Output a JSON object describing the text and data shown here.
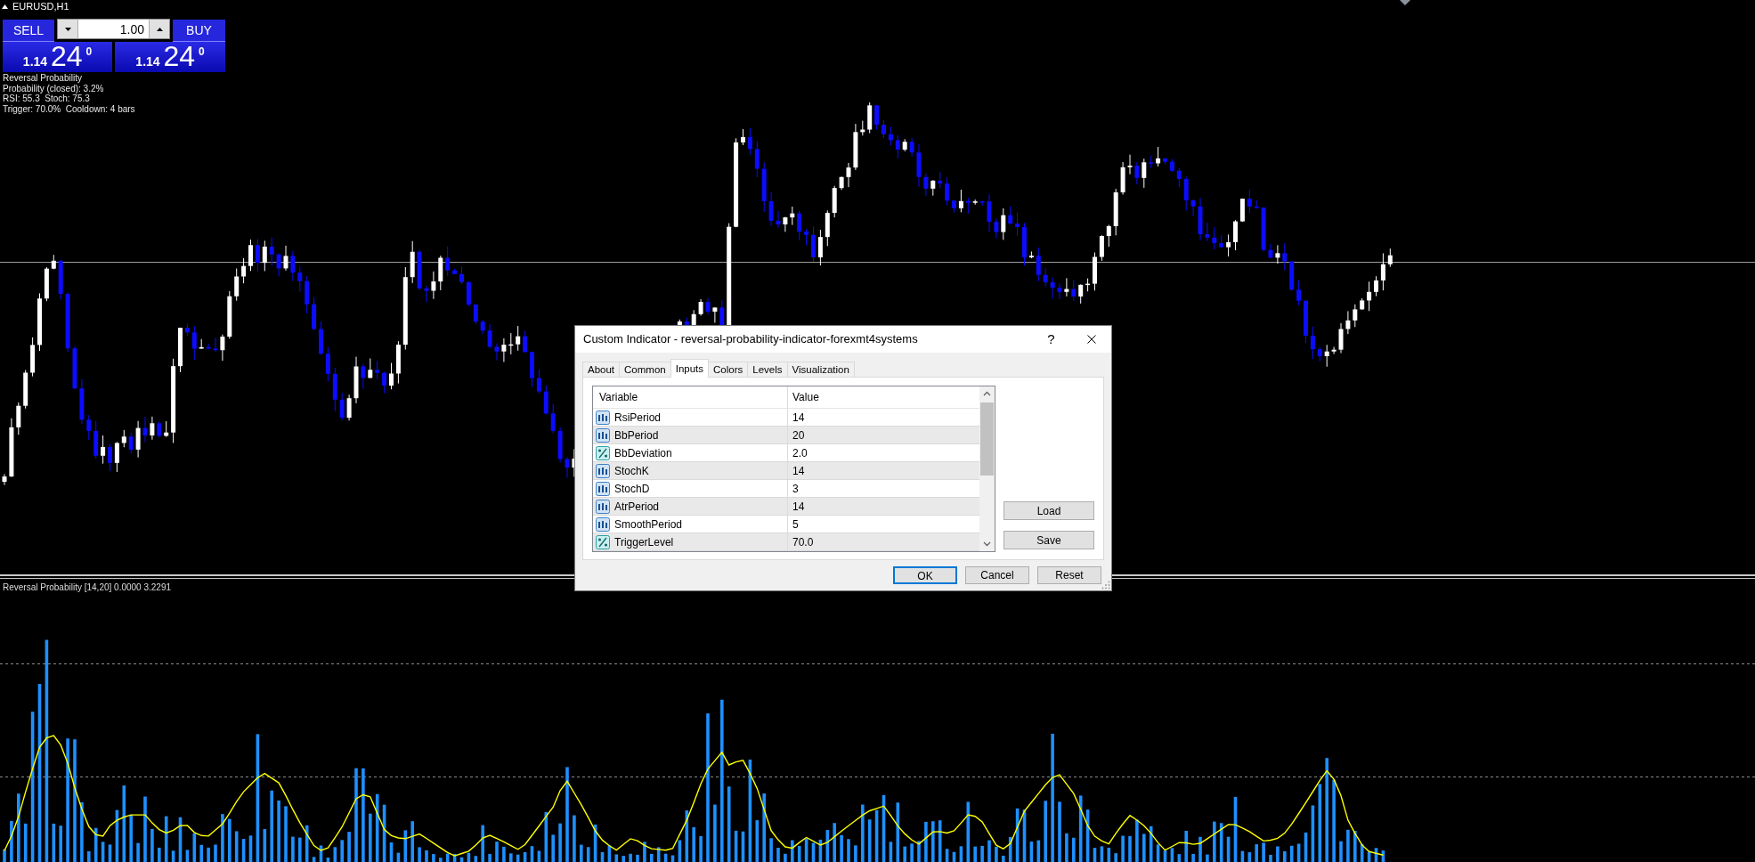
{
  "chart": {
    "symbol": "EURUSD,H1",
    "one_click_trading": {
      "sell_label": "SELL",
      "buy_label": "BUY",
      "lot": "1.00",
      "sell_price": {
        "prefix": "1.14",
        "pips": "24",
        "point": "0"
      },
      "buy_price": {
        "prefix": "1.14",
        "pips": "24",
        "point": "0"
      }
    },
    "indicator_info": [
      "Reversal Probability",
      "Probability (closed): 3.2%",
      "RSI: 55.3  Stoch: 75.3",
      "Trigger: 70.0%  Cooldown: 4 bars"
    ]
  },
  "indicator_window": {
    "label": "Reversal Probability [14,20] 0.0000 3.2291"
  },
  "dialog": {
    "title": "Custom Indicator - reversal-probability-indicator-forexmt4systems",
    "help": "?",
    "tabs": [
      {
        "label": "About",
        "selected": false
      },
      {
        "label": "Common",
        "selected": false
      },
      {
        "label": "Inputs",
        "selected": true
      },
      {
        "label": "Colors",
        "selected": false
      },
      {
        "label": "Levels",
        "selected": false
      },
      {
        "label": "Visualization",
        "selected": false
      }
    ],
    "inputs_table": {
      "columns": [
        "Variable",
        "Value"
      ],
      "rows": [
        {
          "kind": "int",
          "variable": "RsiPeriod",
          "value": "14"
        },
        {
          "kind": "int",
          "variable": "BbPeriod",
          "value": "20"
        },
        {
          "kind": "double",
          "variable": "BbDeviation",
          "value": "2.0"
        },
        {
          "kind": "int",
          "variable": "StochK",
          "value": "14"
        },
        {
          "kind": "int",
          "variable": "StochD",
          "value": "3"
        },
        {
          "kind": "int",
          "variable": "AtrPeriod",
          "value": "14"
        },
        {
          "kind": "int",
          "variable": "SmoothPeriod",
          "value": "5"
        },
        {
          "kind": "double",
          "variable": "TriggerLevel",
          "value": "70.0"
        }
      ]
    },
    "side_buttons": [
      "Load",
      "Save"
    ],
    "buttons": [
      {
        "label": "OK",
        "focused": true
      },
      {
        "label": "Cancel",
        "focused": false
      },
      {
        "label": "Reset",
        "focused": false
      }
    ]
  }
}
